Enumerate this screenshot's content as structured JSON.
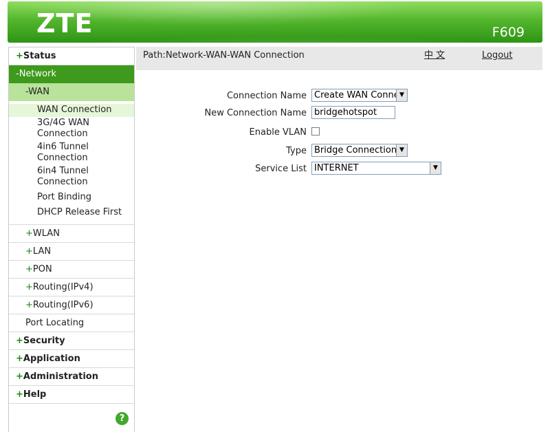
{
  "header": {
    "logo": "ZTE",
    "model": "F609"
  },
  "sidebar": {
    "items": [
      {
        "plus": "+",
        "label": "Status"
      },
      {
        "label": "-Network"
      }
    ],
    "network": {
      "wan": {
        "label": "-WAN"
      },
      "leaves": [
        "WAN Connection",
        "3G/4G WAN Connection",
        "4in6 Tunnel Connection",
        "6in4 Tunnel Connection",
        "Port Binding",
        "DHCP Release First"
      ],
      "subs": [
        {
          "plus": "+",
          "label": "WLAN"
        },
        {
          "plus": "+",
          "label": "LAN"
        },
        {
          "plus": "+",
          "label": "PON"
        },
        {
          "plus": "+",
          "label": "Routing(IPv4)"
        },
        {
          "plus": "+",
          "label": "Routing(IPv6)"
        },
        {
          "label": "Port Locating"
        }
      ]
    },
    "bottom": [
      {
        "plus": "+",
        "label": "Security"
      },
      {
        "plus": "+",
        "label": "Application"
      },
      {
        "plus": "+",
        "label": "Administration"
      },
      {
        "plus": "+",
        "label": "Help"
      }
    ],
    "help_icon": "?"
  },
  "content": {
    "path": "Path:Network-WAN-WAN Connection",
    "lang": "中 文",
    "logout": "Logout",
    "form": {
      "connection_name_label": "Connection Name",
      "connection_name_value": "Create WAN Conne",
      "new_connection_name_label": "New Connection Name",
      "new_connection_name_value": "bridgehotspot",
      "enable_vlan_label": "Enable VLAN",
      "type_label": "Type",
      "type_value": "Bridge Connection",
      "service_list_label": "Service List",
      "service_list_value": "INTERNET"
    }
  }
}
